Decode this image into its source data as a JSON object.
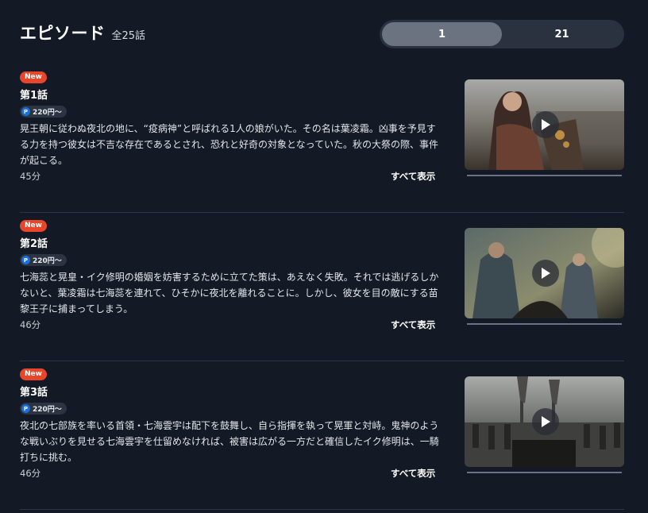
{
  "header": {
    "title": "エピソード",
    "count": "全25話"
  },
  "pager": {
    "tabs": [
      {
        "label": "1",
        "active": true
      },
      {
        "label": "21",
        "active": false
      }
    ]
  },
  "episodes": [
    {
      "badge": "New",
      "title": "第1話",
      "price": "220円〜",
      "price_icon": "P",
      "description": "晃王朝に従わぬ夜北の地に、“疫病神”と呼ばれる1人の娘がいた。その名は葉凌霜。凶事を予見する力を持つ彼女は不吉な存在であるとされ、恐れと好奇の対象となっていた。秋の大祭の際、事件が起こる。",
      "duration": "45分",
      "show_all": "すべて表示",
      "progress": 0
    },
    {
      "badge": "New",
      "title": "第2話",
      "price": "220円〜",
      "price_icon": "P",
      "description": "七海蕊と晃皇・イク修明の婚姻を妨害するために立てた策は、あえなく失敗。それでは逃げるしかないと、葉凌霜は七海蕊を連れて、ひそかに夜北を離れることに。しかし、彼女を目の敵にする苗黎王子に捕まってしまう。",
      "duration": "46分",
      "show_all": "すべて表示",
      "progress": 0
    },
    {
      "badge": "New",
      "title": "第3話",
      "price": "220円〜",
      "price_icon": "P",
      "description": "夜北の七部族を率いる首領・七海雲宇は配下を鼓舞し、自ら指揮を執って晃軍と対峙。鬼神のような戦いぶりを見せる七海雲宇を仕留めなければ、被害は広がる一方だと確信したイク修明は、一騎打ちに挑む。",
      "duration": "46分",
      "show_all": "すべて表示",
      "progress": 0
    }
  ],
  "colors": {
    "background": "#141a25",
    "badge": "#e8462b",
    "pager_active": "#6b7380",
    "point_icon": "#1b6fd8"
  }
}
